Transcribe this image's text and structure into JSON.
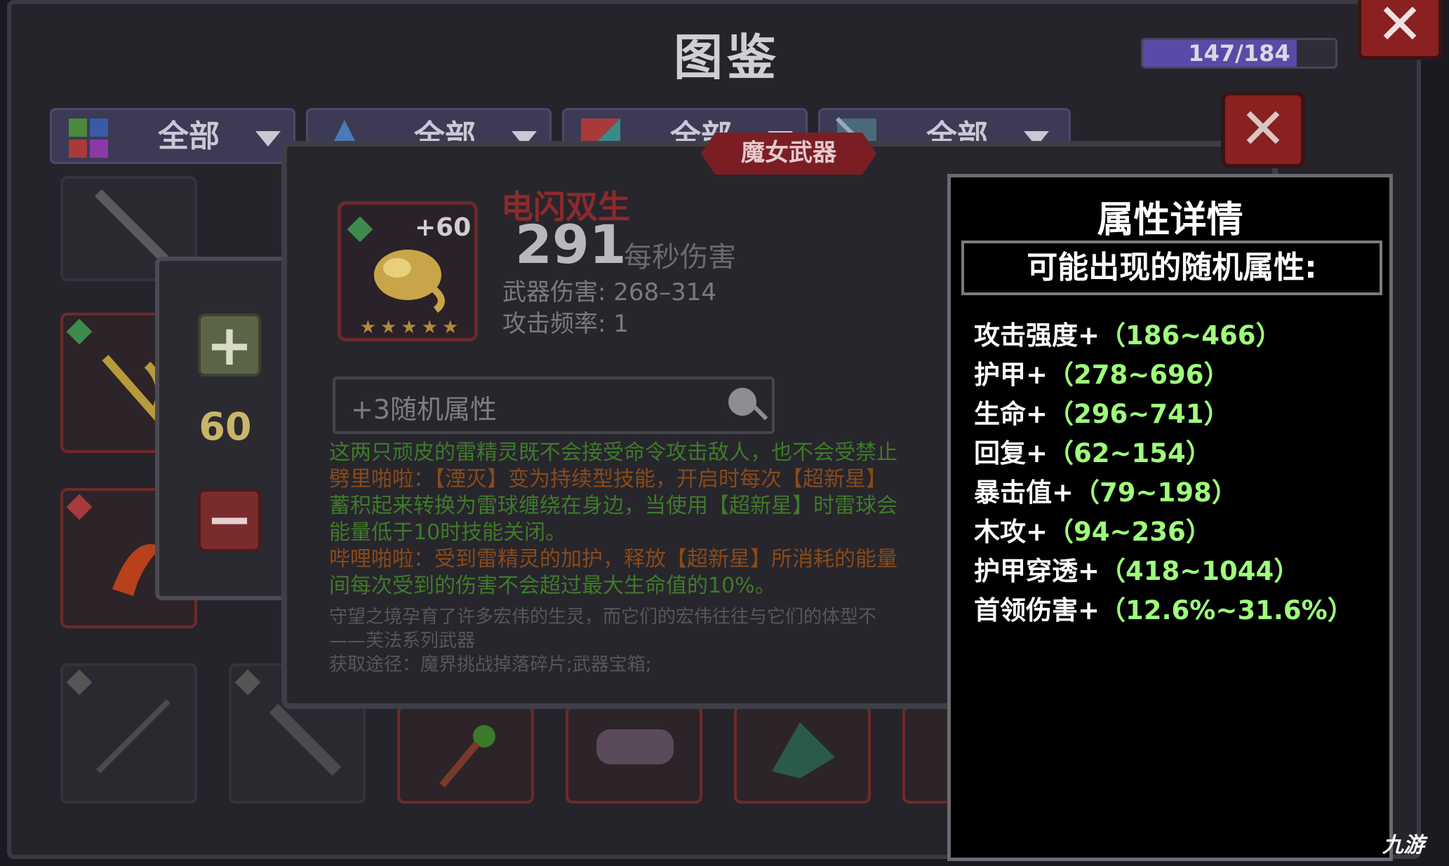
{
  "header": {
    "title": "图鉴",
    "progress_text": "147/184",
    "progress_value": 0.799
  },
  "tabs": [
    {
      "label": "全部",
      "icon": "grid-color-icon"
    },
    {
      "label": "全部",
      "icon": "crystal-icon"
    },
    {
      "label": "全部",
      "icon": "color-block-icon"
    },
    {
      "label": "全部",
      "icon": "pattern-icon"
    }
  ],
  "quantity": {
    "value": "60",
    "plus_icon": "plus-icon",
    "minus_icon": "minus-icon"
  },
  "weapon": {
    "category": "魔女武器",
    "name": "电闪双生",
    "level": "+60",
    "stars": "★★★★★",
    "dps": "291",
    "dps_label": "每秒伤害",
    "damage": "武器伤害: 268–314",
    "attack_rate": "攻击频率: 1",
    "random_attr_label": "+3随机属性",
    "desc_lines": [
      {
        "text": "这两只顽皮的雷精灵既不会接受命令攻击敌人，也不会受禁止",
        "style": "green"
      },
      {
        "text": "劈里啪啦：【湮灭】变为持续型技能，开启时每次【超新星】",
        "style": "orange"
      },
      {
        "text": "蓄积起来转换为雷球缠绕在身边，当使用【超新星】时雷球会",
        "style": "green"
      },
      {
        "text": "能量低于10时技能关闭。",
        "style": "green"
      },
      {
        "text": "哔哩啪啦：受到雷精灵的加护，释放【超新星】所消耗的能量",
        "style": "orange"
      },
      {
        "text": "间每次受到的伤害不会超过最大生命值的10%。",
        "style": "green"
      },
      {
        "text": "守望之境孕育了许多宏伟的生灵，而它们的宏伟往往与它们的体型不",
        "style": "grey"
      },
      {
        "text": "——芙法系列武器",
        "style": "grey"
      },
      {
        "text": "获取途径：魔界挑战掉落碎片;武器宝箱;",
        "style": "grey"
      }
    ]
  },
  "attributes": {
    "title": "属性详情",
    "subtitle": "可能出现的随机属性:",
    "items": [
      {
        "name": "攻击强度+",
        "range": "（186~466）"
      },
      {
        "name": "护甲+",
        "range": "（278~696）"
      },
      {
        "name": "生命+",
        "range": "（296~741）"
      },
      {
        "name": "回复+",
        "range": "（62~154）"
      },
      {
        "name": "暴击值+",
        "range": "（79~198）"
      },
      {
        "name": "木攻+",
        "range": "（94~236）"
      },
      {
        "name": "护甲穿透+",
        "range": "（418~1044）"
      },
      {
        "name": "首领伤害+",
        "range": "（12.6%~31.6%）"
      }
    ]
  },
  "close_icon": "close-icon",
  "watermark": "九游"
}
